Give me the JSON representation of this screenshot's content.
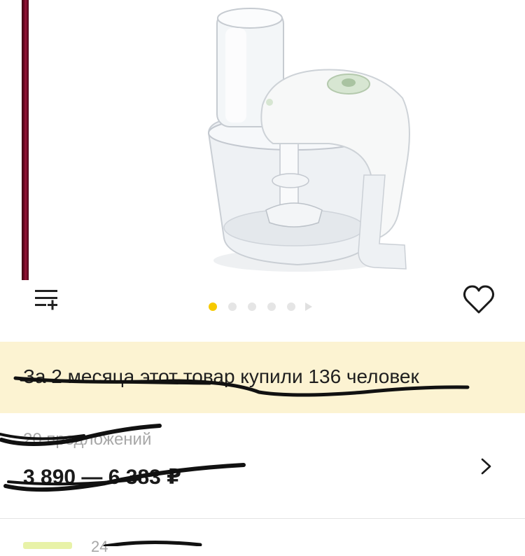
{
  "gallery": {
    "image_icon": "food-processor-image",
    "dots_total": 5,
    "active_dot": 1
  },
  "toolbar": {
    "add_to_list_icon": "playlist-add-icon",
    "favorite_icon": "heart-outline-icon"
  },
  "banner": {
    "text": "За 2 месяца этот товар купили 136 человек"
  },
  "offers": {
    "count_label": "20 предложений",
    "price_range": "3 890 — 6 383 ₽",
    "chevron_icon": "chevron-right-icon"
  },
  "next_item": {
    "text": "24"
  },
  "colors": {
    "accent_yellow": "#f6c900",
    "banner_bg": "#fcf3d2",
    "muted_text": "#a8a8a8",
    "scribble": "#111111"
  }
}
